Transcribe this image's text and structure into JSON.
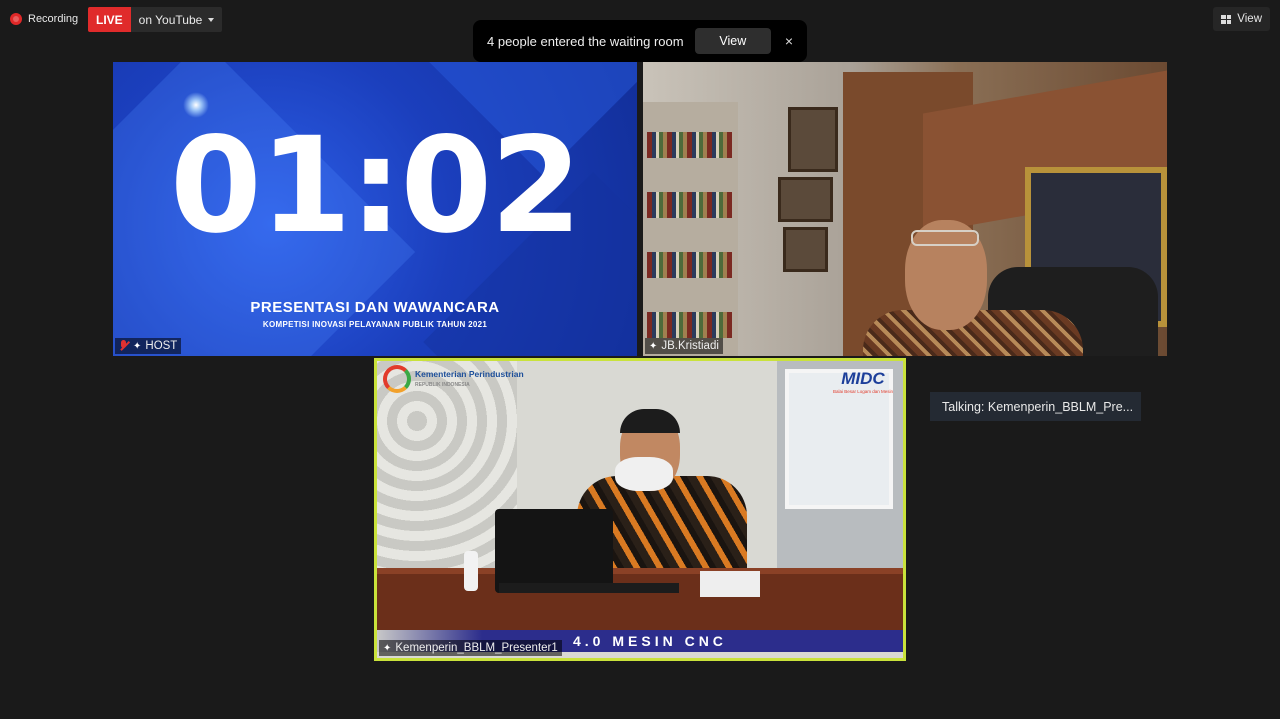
{
  "topbar": {
    "recording_label": "Recording",
    "live_label": "LIVE",
    "live_destination": "on YouTube",
    "view_label": "View"
  },
  "waiting_room": {
    "message": "4 people entered the waiting room",
    "view_button": "View",
    "close_glyph": "×"
  },
  "tiles": {
    "host": {
      "label": "HOST",
      "timer": "01:02",
      "title": "PRESENTASI DAN WAWANCARA",
      "subtitle": "KOMPETISI INOVASI PELAYANAN PUBLIK TAHUN 2021"
    },
    "jb": {
      "label": "JB.Kristiadi"
    },
    "presenter": {
      "label": "Kemenperin_BBLM_Presenter1",
      "logo_text": "Kementerian Perindustrian",
      "logo_sub": "REPUBLIK INDONESIA",
      "midc_text": "MIDC",
      "midc_sub": "Balai Besar Logam dan Mesin",
      "banner_text": "4.0 MESIN CNC",
      "border_color": "#c9e23b"
    }
  },
  "talking": {
    "text": "Talking:  Kemenperin_BBLM_Pre..."
  },
  "colors": {
    "live": "#e02b2b",
    "background": "#1a1a1a",
    "talking_bg": "#242a33"
  }
}
